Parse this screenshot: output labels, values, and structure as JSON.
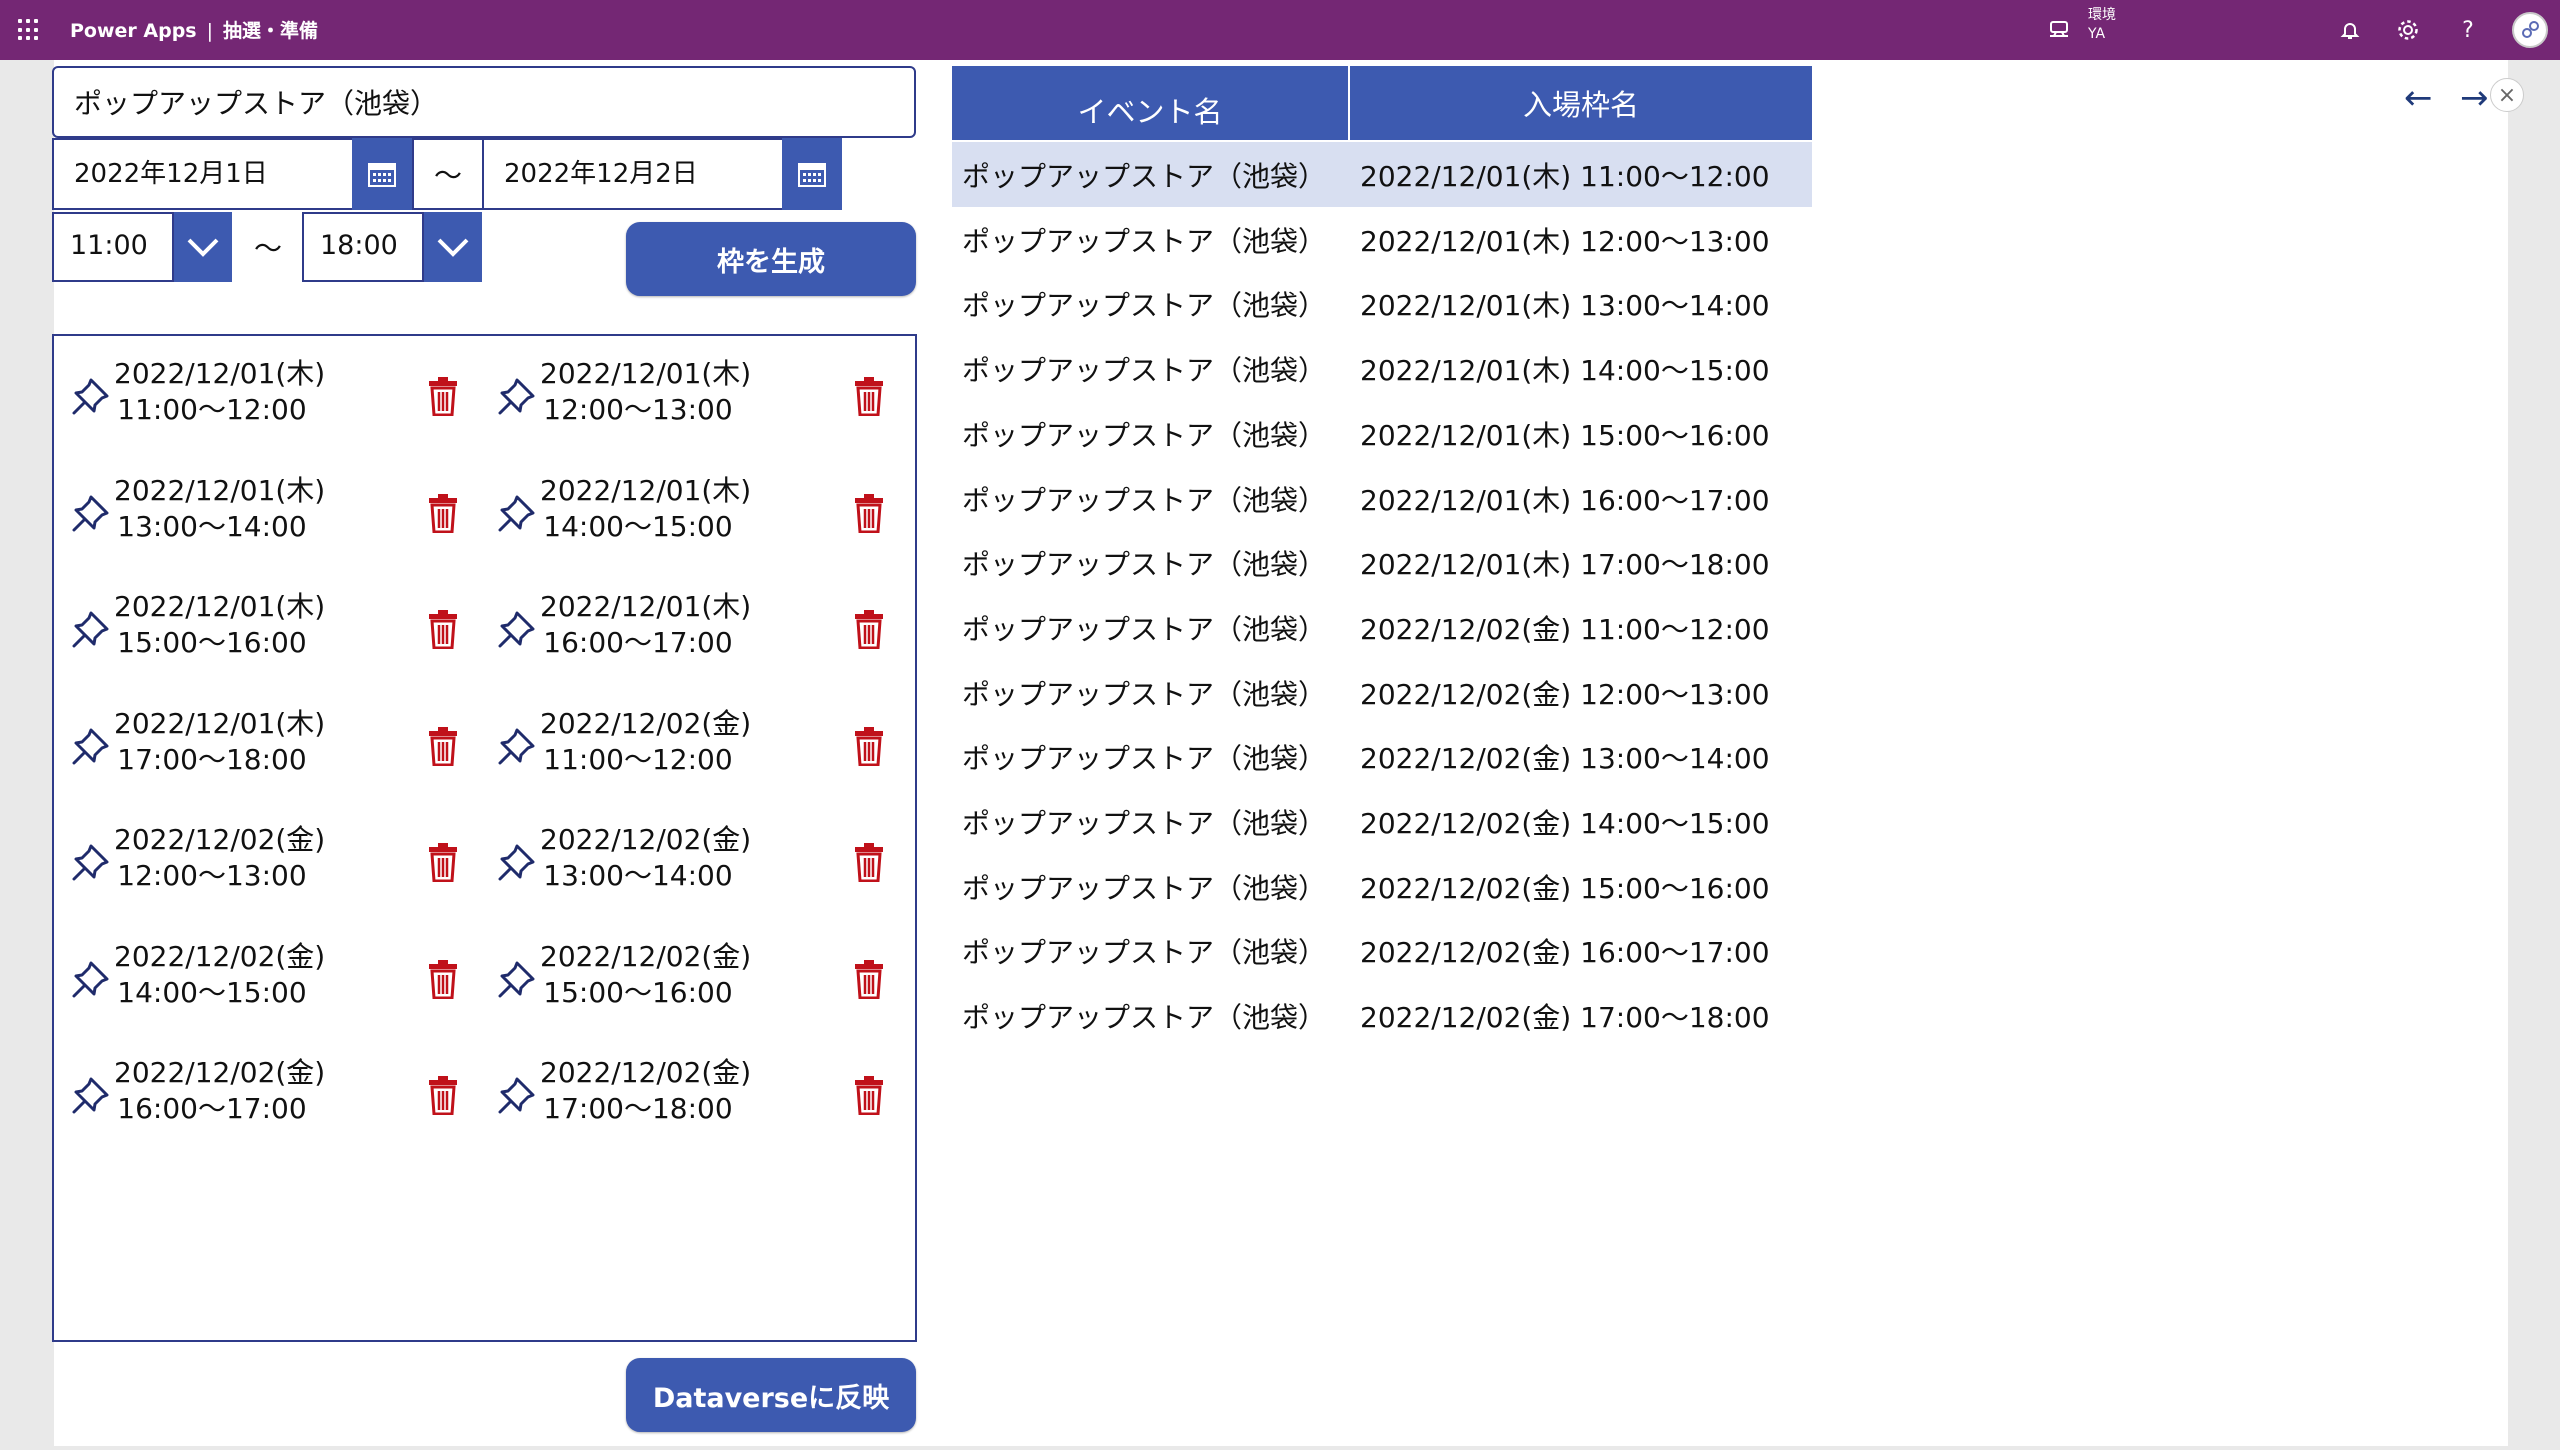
{
  "topbar": {
    "app": "Power Apps",
    "separator": "|",
    "screen": "抽選・準備",
    "env_label": "環境",
    "env_value": "YA"
  },
  "form": {
    "event_name": "ポップアップストア（池袋）",
    "date_from": "2022年12月1日",
    "date_to": "2022年12月2日",
    "tilde": "～",
    "time_from": "11:00",
    "time_to": "18:00",
    "generate_label": "枠を生成",
    "dataverse_label": "Dataverseに反映"
  },
  "gallery": [
    {
      "date": "2022/12/01(木)",
      "time": "11:00～12:00"
    },
    {
      "date": "2022/12/01(木)",
      "time": "12:00～13:00"
    },
    {
      "date": "2022/12/01(木)",
      "time": "13:00～14:00"
    },
    {
      "date": "2022/12/01(木)",
      "time": "14:00～15:00"
    },
    {
      "date": "2022/12/01(木)",
      "time": "15:00～16:00"
    },
    {
      "date": "2022/12/01(木)",
      "time": "16:00～17:00"
    },
    {
      "date": "2022/12/01(木)",
      "time": "17:00～18:00"
    },
    {
      "date": "2022/12/02(金)",
      "time": "11:00～12:00"
    },
    {
      "date": "2022/12/02(金)",
      "time": "12:00～13:00"
    },
    {
      "date": "2022/12/02(金)",
      "time": "13:00～14:00"
    },
    {
      "date": "2022/12/02(金)",
      "time": "14:00～15:00"
    },
    {
      "date": "2022/12/02(金)",
      "time": "15:00～16:00"
    },
    {
      "date": "2022/12/02(金)",
      "time": "16:00～17:00"
    },
    {
      "date": "2022/12/02(金)",
      "time": "17:00～18:00"
    }
  ],
  "table": {
    "headers": [
      "イベント名",
      "入場枠名"
    ],
    "rows": [
      [
        "ポップアップストア（池袋）",
        "2022/12/01(木) 11:00～12:00"
      ],
      [
        "ポップアップストア（池袋）",
        "2022/12/01(木) 12:00～13:00"
      ],
      [
        "ポップアップストア（池袋）",
        "2022/12/01(木) 13:00～14:00"
      ],
      [
        "ポップアップストア（池袋）",
        "2022/12/01(木) 14:00～15:00"
      ],
      [
        "ポップアップストア（池袋）",
        "2022/12/01(木) 15:00～16:00"
      ],
      [
        "ポップアップストア（池袋）",
        "2022/12/01(木) 16:00～17:00"
      ],
      [
        "ポップアップストア（池袋）",
        "2022/12/01(木) 17:00～18:00"
      ],
      [
        "ポップアップストア（池袋）",
        "2022/12/02(金) 11:00～12:00"
      ],
      [
        "ポップアップストア（池袋）",
        "2022/12/02(金) 12:00～13:00"
      ],
      [
        "ポップアップストア（池袋）",
        "2022/12/02(金) 13:00～14:00"
      ],
      [
        "ポップアップストア（池袋）",
        "2022/12/02(金) 14:00～15:00"
      ],
      [
        "ポップアップストア（池袋）",
        "2022/12/02(金) 15:00～16:00"
      ],
      [
        "ポップアップストア（池袋）",
        "2022/12/02(金) 16:00～17:00"
      ],
      [
        "ポップアップストア（池袋）",
        "2022/12/02(金) 17:00～18:00"
      ]
    ]
  },
  "icons": {
    "waffle": "app-launcher-icon",
    "environment": "environment-icon",
    "bell": "notification-icon",
    "settings": "gear-icon",
    "help": "help-icon",
    "pin": "pin-icon",
    "trash": "trash-icon",
    "calendar": "calendar-icon",
    "dropdown": "chevron-down-icon",
    "back": "←",
    "forward": "→",
    "close": "×"
  },
  "colors": {
    "topbar": "#742774",
    "accent": "#3d5ab0",
    "border": "#2f3b8a",
    "selected_row": "#d8dff1",
    "trash": "#c0111a"
  }
}
